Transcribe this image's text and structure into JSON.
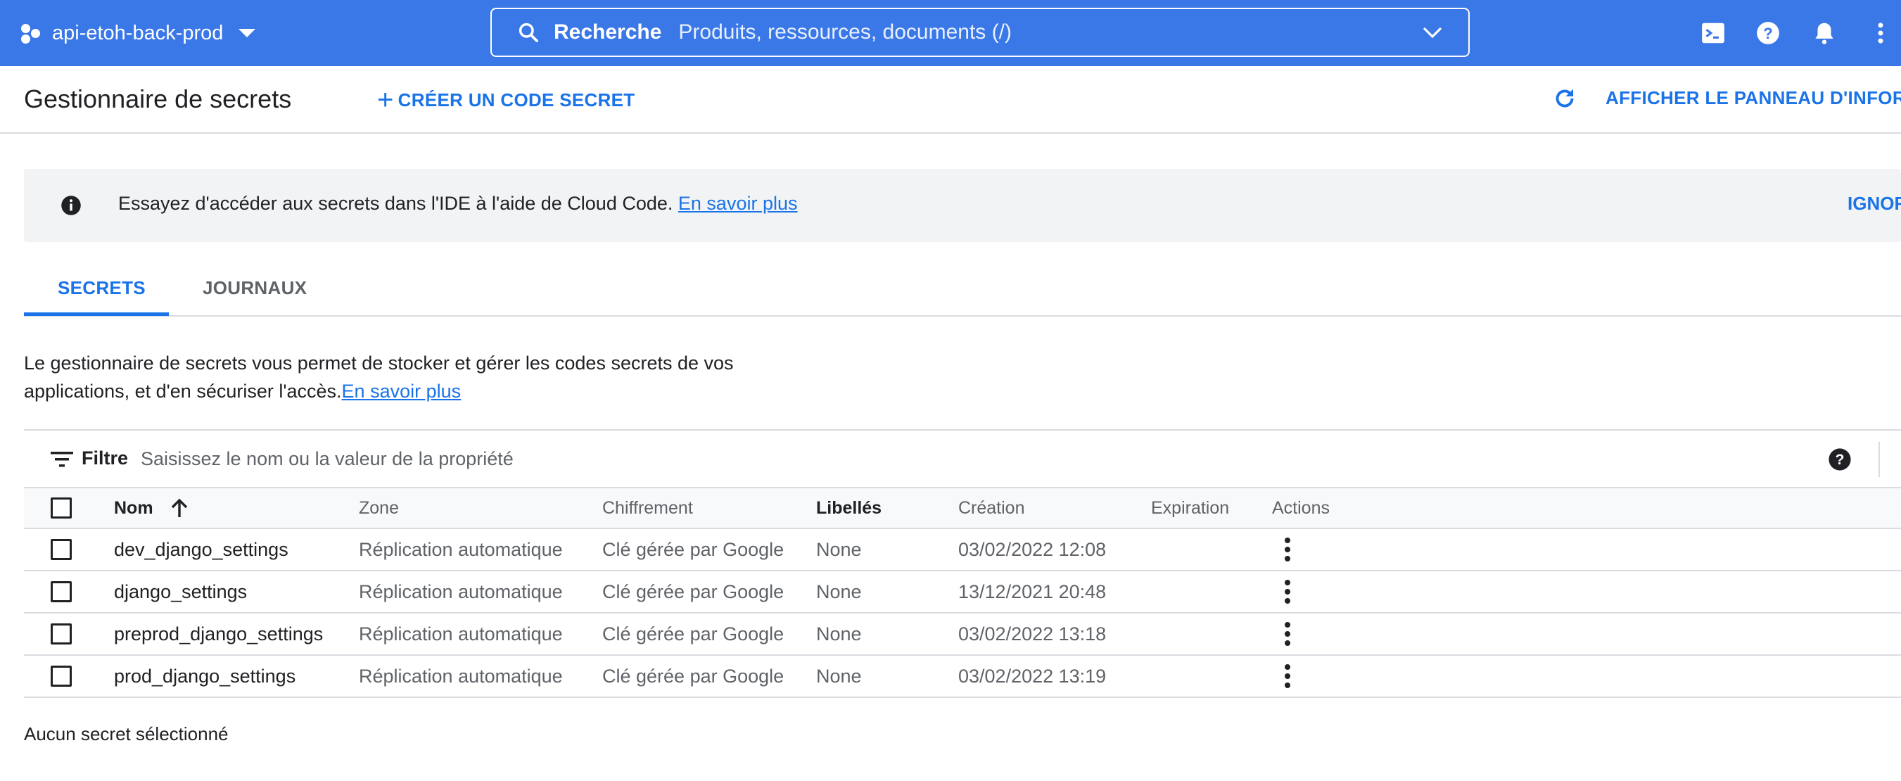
{
  "topbar": {
    "project_name": "api-etoh-back-prod",
    "search_label": "Recherche",
    "search_placeholder": "Produits, ressources, documents (/)",
    "brand_color": "#3b78e7",
    "icons": [
      "project-icon",
      "search-icon",
      "terminal-icon",
      "help-icon",
      "notifications-icon",
      "more-vert-icon"
    ]
  },
  "header": {
    "title": "Gestionnaire de secrets",
    "create_label": "CRÉER UN CODE SECRET",
    "info_panel_label": "AFFICHER LE PANNEAU D'INFORMA"
  },
  "banner": {
    "text": "Essayez d'accéder aux secrets dans l'IDE à l'aide de Cloud Code. ",
    "link": "En savoir plus",
    "dismiss": "IGNOR"
  },
  "tabs": [
    {
      "label": "SECRETS",
      "active": true
    },
    {
      "label": "JOURNAUX",
      "active": false
    }
  ],
  "description": {
    "line1": "Le gestionnaire de secrets vous permet de stocker et gérer les codes secrets de vos",
    "line2": "applications, et d'en sécuriser l'accès.",
    "link": "En savoir plus"
  },
  "filter": {
    "label": "Filtre",
    "placeholder": "Saisissez le nom ou la valeur de la propriété"
  },
  "table": {
    "headers": {
      "name": "Nom",
      "zone": "Zone",
      "encryption": "Chiffrement",
      "labels": "Libellés",
      "created": "Création",
      "expiration": "Expiration",
      "actions": "Actions"
    },
    "rows": [
      {
        "name": "dev_django_settings",
        "zone": "Réplication automatique",
        "encryption": "Clé gérée par Google",
        "labels": "None",
        "created": "03/02/2022 12:08",
        "expiration": ""
      },
      {
        "name": "django_settings",
        "zone": "Réplication automatique",
        "encryption": "Clé gérée par Google",
        "labels": "None",
        "created": "13/12/2021 20:48",
        "expiration": ""
      },
      {
        "name": "preprod_django_settings",
        "zone": "Réplication automatique",
        "encryption": "Clé gérée par Google",
        "labels": "None",
        "created": "03/02/2022 13:18",
        "expiration": ""
      },
      {
        "name": "prod_django_settings",
        "zone": "Réplication automatique",
        "encryption": "Clé gérée par Google",
        "labels": "None",
        "created": "03/02/2022 13:19",
        "expiration": ""
      }
    ]
  },
  "status": {
    "selection": "Aucun secret sélectionné"
  }
}
